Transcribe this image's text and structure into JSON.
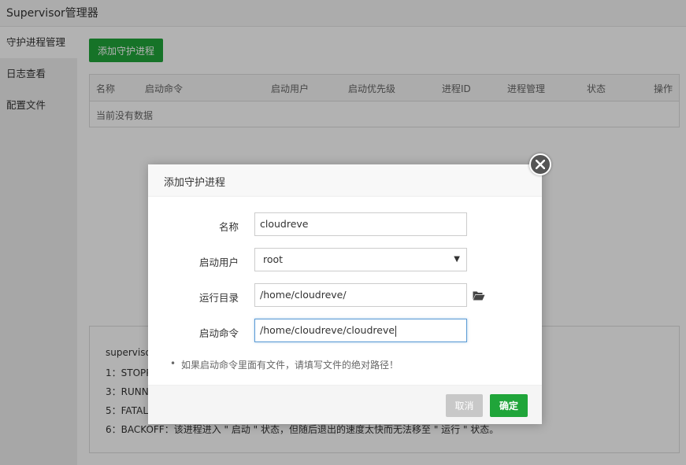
{
  "app": {
    "title": "Supervisor管理器"
  },
  "sidebar": {
    "items": [
      {
        "label": "守护进程管理",
        "active": true
      },
      {
        "label": "日志查看",
        "active": false
      },
      {
        "label": "配置文件",
        "active": false
      }
    ]
  },
  "main": {
    "add_button": "添加守护进程",
    "table": {
      "columns": [
        "名称",
        "启动命令",
        "启动用户",
        "启动优先级",
        "进程ID",
        "进程管理",
        "状态",
        "操作"
      ],
      "empty_text": "当前没有数据"
    },
    "info": {
      "lines": [
        "supervisor",
        "1：STOPP",
        "3：RUNN",
        "5：FATAL",
        "6：BACKOFF：该进程进入 \" 启动 \" 状态，但随后退出的速度太快而无法移至 \" 运行 \" 状态。"
      ]
    }
  },
  "dialog": {
    "title": "添加守护进程",
    "fields": {
      "name": {
        "label": "名称",
        "value": "cloudreve"
      },
      "user": {
        "label": "启动用户",
        "value": "root"
      },
      "dir": {
        "label": "运行目录",
        "value": "/home/cloudreve/"
      },
      "command": {
        "label": "启动命令",
        "value": "/home/cloudreve/cloudreve"
      }
    },
    "note": "如果启动命令里面有文件，请填写文件的绝对路径！",
    "cancel": "取消",
    "confirm": "确定"
  },
  "colors": {
    "primary": "#20a53a",
    "overlay": "rgba(0,0,0,0.3)",
    "focus": "#5b9bd5"
  }
}
